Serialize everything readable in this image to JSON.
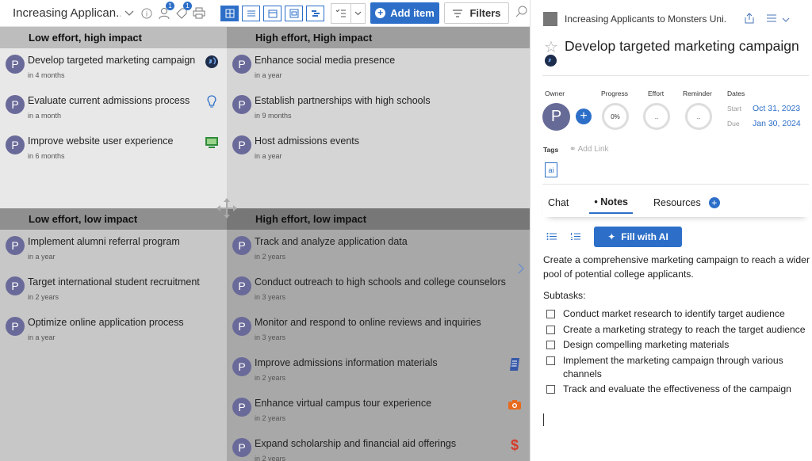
{
  "toolbar": {
    "title": "Increasing Applican...",
    "badge_users": "1",
    "badge_tags": "1",
    "add_item_label": "Add item",
    "filters_label": "Filters"
  },
  "quadrants": [
    {
      "title": "Low effort, high impact",
      "items": [
        {
          "title": "Develop targeted marketing campaign",
          "due": "in 4 months",
          "icon": "globe-icon"
        },
        {
          "title": "Evaluate current admissions process",
          "due": "in a month",
          "icon": "lightbulb-icon"
        },
        {
          "title": "Improve website user experience",
          "due": "in 6 months",
          "icon": "computer-icon"
        }
      ]
    },
    {
      "title": "High effort, High impact",
      "items": [
        {
          "title": "Enhance social media presence",
          "due": "in a year"
        },
        {
          "title": "Establish partnerships with high schools",
          "due": "in 9 months"
        },
        {
          "title": "Host admissions events",
          "due": "in a year"
        }
      ]
    },
    {
      "title": "Low effort, low impact",
      "items": [
        {
          "title": "Implement alumni referral program",
          "due": "in a year"
        },
        {
          "title": "Target international student recruitment",
          "due": "in 2 years"
        },
        {
          "title": "Optimize online application process",
          "due": "in a year"
        }
      ]
    },
    {
      "title": "High effort, low impact",
      "items": [
        {
          "title": "Track and analyze application data",
          "due": "in 2 years"
        },
        {
          "title": "Conduct outreach to high schools and college counselors",
          "due": "in 3 years"
        },
        {
          "title": "Monitor and respond to online reviews and inquiries",
          "due": "in 3 years"
        },
        {
          "title": "Improve admissions information materials",
          "due": "in 2 years",
          "icon": "document-icon"
        },
        {
          "title": "Enhance virtual campus tour experience",
          "due": "in 2 years",
          "icon": "camera-icon"
        },
        {
          "title": "Expand scholarship and financial aid offerings",
          "due": "in 2 years",
          "icon": "dollar-icon"
        }
      ]
    }
  ],
  "avatar_letter": "P",
  "panel": {
    "header_title": "Increasing Applicants to Monsters Uni...",
    "title": "Develop targeted marketing campaign",
    "owner_label": "Owner",
    "progress_label": "Progress",
    "progress_value": "0%",
    "effort_label": "Effort",
    "effort_value": "..",
    "reminder_label": "Reminder",
    "reminder_value": "..",
    "dates_label": "Dates",
    "start_label": "Start",
    "start_date": "Oct 31, 2023",
    "due_label": "Due",
    "due_date": "Jan 30, 2024",
    "tags_label": "Tags",
    "add_link_label": "Add Link",
    "tag": "ai",
    "tabs": [
      "Chat",
      "Notes",
      "Resources"
    ],
    "fill_ai_label": "Fill with AI",
    "note_text": "Create a comprehensive marketing campaign to reach a wider pool of potential college applicants.",
    "subtasks_label": "Subtasks:",
    "subtasks": [
      "Conduct market research to identify target audience",
      "Create a marketing strategy to reach the target audience",
      "Design compelling marketing materials",
      "Implement the marketing campaign through various channels",
      "Track and evaluate the effectiveness of the campaign"
    ]
  }
}
